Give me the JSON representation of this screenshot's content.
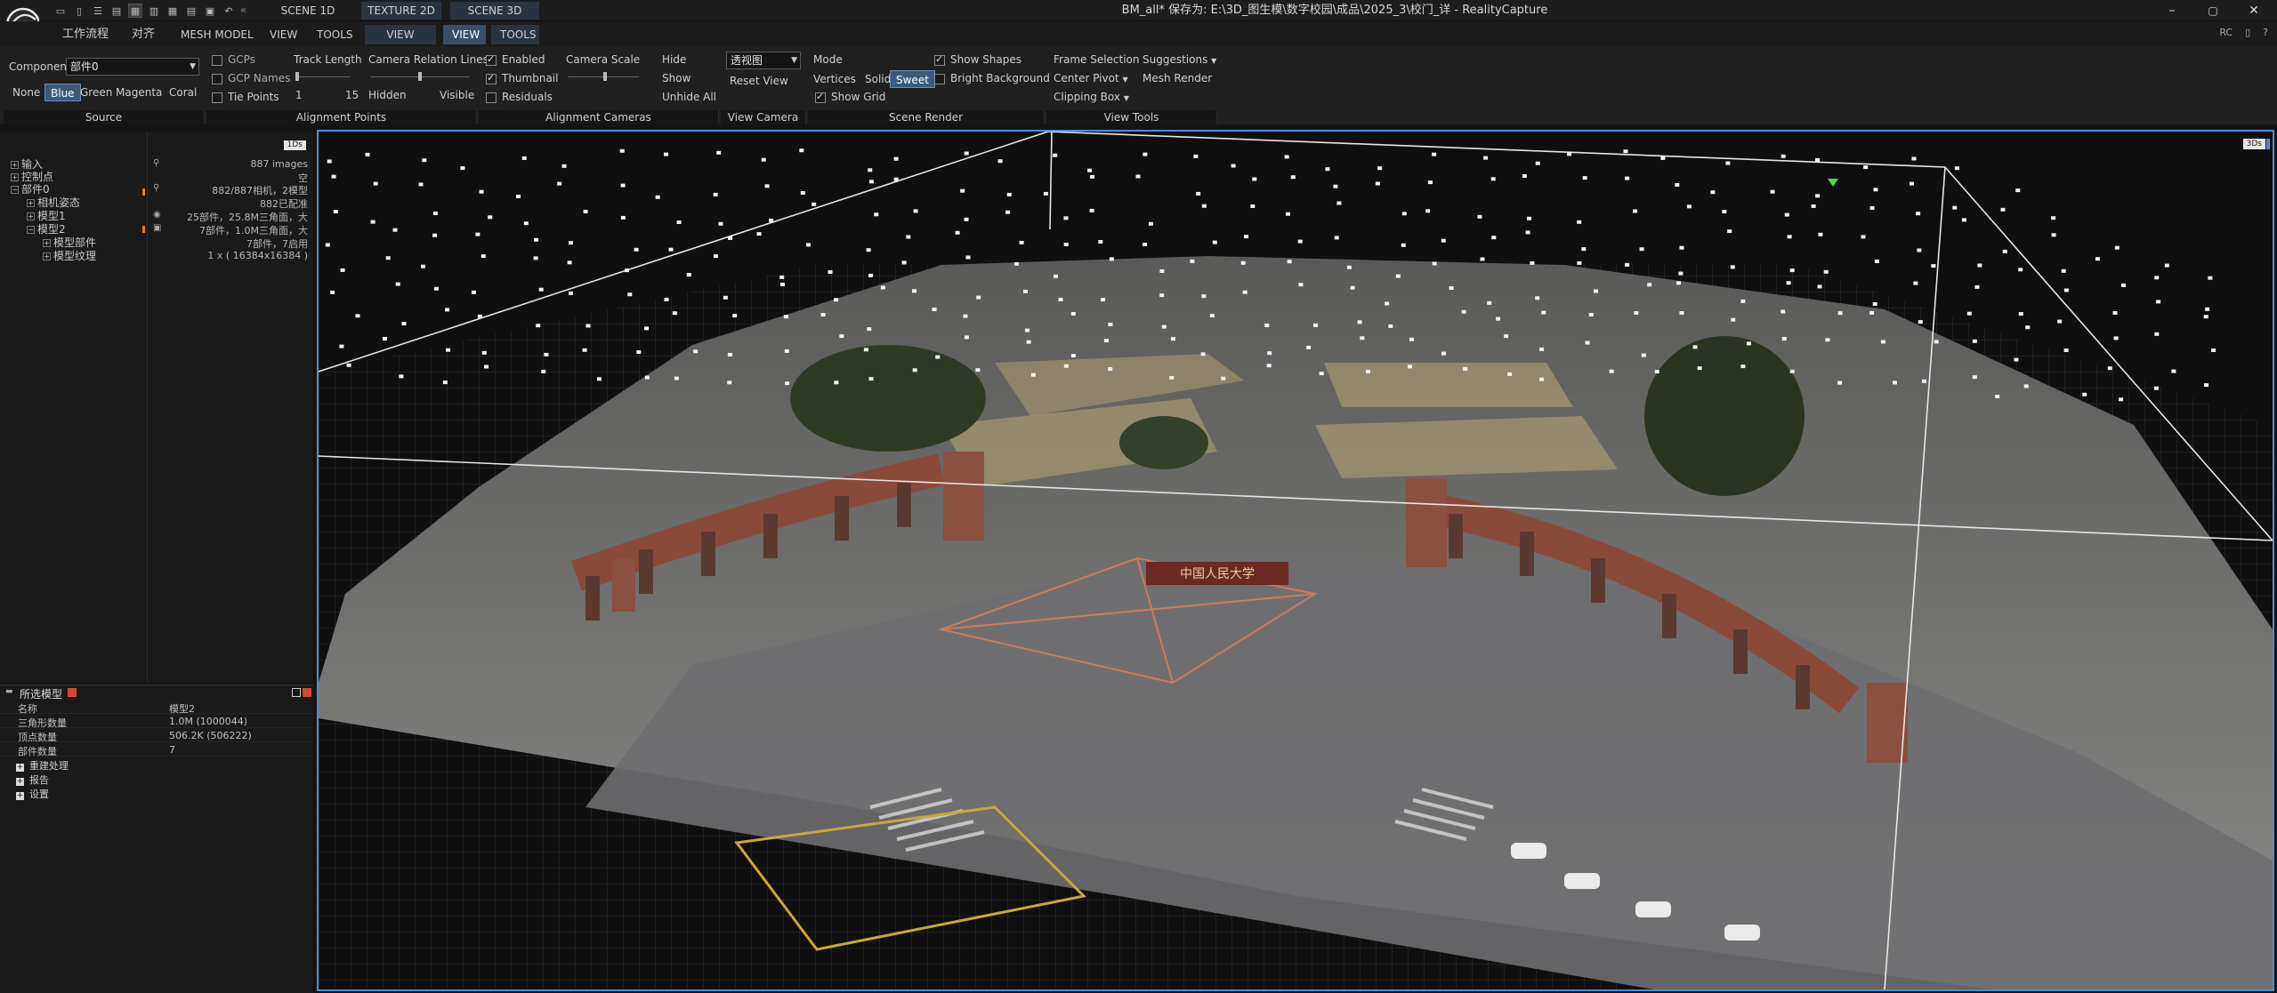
{
  "titlebar": {
    "title": "BM_all* 保存为: E:\\3D_图生模\\数字校园\\成品\\2025_3\\校门_详 - RealityCapture",
    "layout_sep": "«",
    "scene_tabs": [
      "SCENE 1D",
      "TEXTURE 2D",
      "SCENE 3D"
    ],
    "controls": {
      "minimize": "–",
      "maximize": "▢",
      "close": "✕"
    }
  },
  "ribbon_tabs": {
    "items": [
      "工作流程",
      "对齐",
      "MESH MODEL",
      "VIEW",
      "TOOLS",
      "VIEW",
      "VIEW",
      "TOOLS"
    ],
    "right": [
      "RC",
      "▯",
      "?"
    ]
  },
  "ribbon": {
    "source": {
      "component_label": "Component",
      "component_value": "部件0",
      "colors": [
        "None",
        "Blue",
        "Green",
        "Magenta",
        "Coral"
      ],
      "selected_color": "Blue",
      "group_label": "Source"
    },
    "alignment_points": {
      "gcps": "GCPs",
      "gcp_names": "GCP Names",
      "tie_points": "Tie Points",
      "track_length": "Track Length",
      "track_min": "1",
      "track_max": "15",
      "camera_relation": "Camera Relation Lines",
      "hidden": "Hidden",
      "visible": "Visible",
      "group_label": "Alignment Points"
    },
    "alignment_cameras": {
      "enabled": "Enabled",
      "thumbnail": "Thumbnail",
      "residuals": "Residuals",
      "camera_scale": "Camera Scale",
      "hide": "Hide",
      "show": "Show",
      "unhide_all": "Unhide All",
      "group_label": "Alignment Cameras"
    },
    "view_camera": {
      "view_value": "透视图",
      "reset_view": "Reset View",
      "group_label": "View Camera"
    },
    "scene_render": {
      "mode": "Mode",
      "modes": [
        "Vertices",
        "Solid",
        "Sweet"
      ],
      "selected_mode": "Sweet",
      "show_shapes": "Show Shapes",
      "bright_background": "Bright Background",
      "show_grid": "Show Grid",
      "group_label": "Scene Render"
    },
    "view_tools": {
      "frame_selection": "Frame Selection",
      "suggestions": "Suggestions",
      "center_pivot": "Center Pivot",
      "mesh_render": "Mesh Render",
      "clipping_box": "Clipping Box",
      "group_label": "View Tools"
    }
  },
  "tree": {
    "badge": "1Ds",
    "items": [
      {
        "label": "输入",
        "indent": 0,
        "sign": "+"
      },
      {
        "label": "控制点",
        "indent": 0,
        "sign": "+"
      },
      {
        "label": "部件0",
        "indent": 0,
        "sign": "−"
      },
      {
        "label": "相机姿态",
        "indent": 1,
        "sign": "+"
      },
      {
        "label": "模型1",
        "indent": 1,
        "sign": "+"
      },
      {
        "label": "模型2",
        "indent": 1,
        "sign": "−"
      },
      {
        "label": "模型部件",
        "indent": 2,
        "sign": "+"
      },
      {
        "label": "模型纹理",
        "indent": 2,
        "sign": "+"
      }
    ],
    "info": [
      "887 images",
      "空",
      "882/887相机，2模型",
      "882已配准",
      "25部件，25.8M三角面，大",
      "7部件，1.0M三角面，大",
      "7部件，7启用",
      "1 x ( 16384x16384 )"
    ]
  },
  "properties": {
    "title": "所选模型",
    "rows": [
      {
        "k": "名称",
        "v": "模型2"
      },
      {
        "k": "三角形数量",
        "v": "1.0M (1000044)"
      },
      {
        "k": "顶点数量",
        "v": "506.2K (506222)"
      },
      {
        "k": "部件数量",
        "v": "7"
      }
    ],
    "sections": [
      "重建处理",
      "报告",
      "设置"
    ]
  },
  "viewport": {
    "badge": "3Ds",
    "sign_text": "中国人民大学"
  }
}
